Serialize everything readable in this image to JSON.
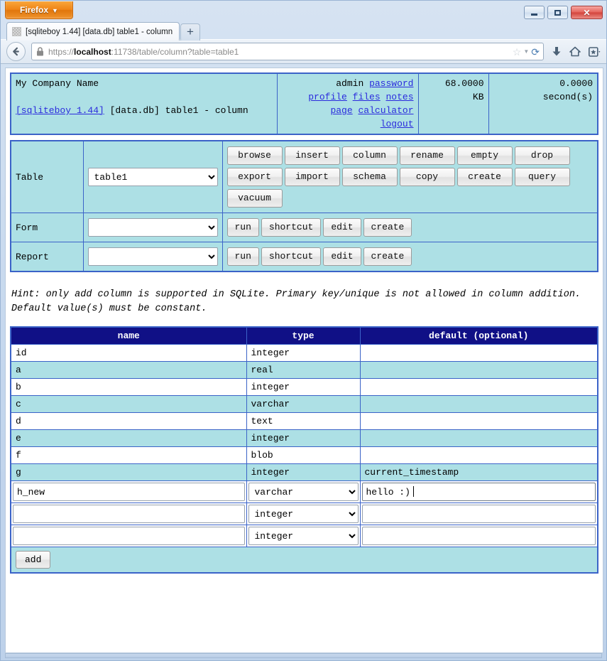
{
  "browser": {
    "app_button": "Firefox",
    "app_button_caret": "▼",
    "tab_title": "[sqliteboy 1.44] [data.db] table1 - column",
    "new_tab_label": "+",
    "url_scheme": "https://",
    "url_host": "localhost",
    "url_rest": ":11738/table/column?table=table1",
    "window_controls": {
      "minimize": "minimize",
      "maximize": "maximize",
      "close": "✕"
    }
  },
  "header": {
    "company": "My Company Name",
    "app_link": "[sqliteboy 1.44]",
    "context": " [data.db] table1 - column",
    "user": "admin",
    "links": [
      "password",
      "profile",
      "files",
      "notes",
      "page",
      "calculator",
      "logout"
    ],
    "db_size": "68.0000",
    "db_size_unit": "KB",
    "elapsed": "0.0000",
    "elapsed_unit": "second(s)"
  },
  "toolbar": {
    "table": {
      "label": "Table",
      "selected": "table1",
      "options": [
        "table1"
      ],
      "buttons": [
        "browse",
        "insert",
        "column",
        "rename",
        "empty",
        "drop",
        "export",
        "import",
        "schema",
        "copy",
        "create",
        "query",
        "vacuum"
      ]
    },
    "form": {
      "label": "Form",
      "selected": "",
      "options": [
        ""
      ],
      "buttons": [
        "run",
        "shortcut",
        "edit",
        "create"
      ]
    },
    "report": {
      "label": "Report",
      "selected": "",
      "options": [
        ""
      ],
      "buttons": [
        "run",
        "shortcut",
        "edit",
        "create"
      ]
    }
  },
  "hint": "Hint: only add column is supported in SQLite. Primary key/unique is not allowed in column addition. Default value(s) must be constant.",
  "columns_table": {
    "headers": [
      "name",
      "type",
      "default (optional)"
    ],
    "rows": [
      {
        "name": "id",
        "type": "integer",
        "default": ""
      },
      {
        "name": "a",
        "type": "real",
        "default": ""
      },
      {
        "name": "b",
        "type": "integer",
        "default": ""
      },
      {
        "name": "c",
        "type": "varchar",
        "default": ""
      },
      {
        "name": "d",
        "type": "text",
        "default": ""
      },
      {
        "name": "e",
        "type": "integer",
        "default": ""
      },
      {
        "name": "f",
        "type": "blob",
        "default": ""
      },
      {
        "name": "g",
        "type": "integer",
        "default": "current_timestamp"
      }
    ],
    "new_rows": [
      {
        "name": "h_new",
        "type": "varchar",
        "default": "hello :)",
        "focused": true
      },
      {
        "name": "",
        "type": "integer",
        "default": "",
        "focused": false
      },
      {
        "name": "",
        "type": "integer",
        "default": "",
        "focused": false
      }
    ],
    "type_options": [
      "integer",
      "real",
      "varchar",
      "text",
      "blob"
    ],
    "add_button": "add"
  },
  "colors": {
    "accent_border": "#3b63c8",
    "panel_bg": "#ade0e5",
    "table_header_bg": "#101086",
    "link": "#2b2bdd",
    "firefox_orange": "#ef8416"
  }
}
